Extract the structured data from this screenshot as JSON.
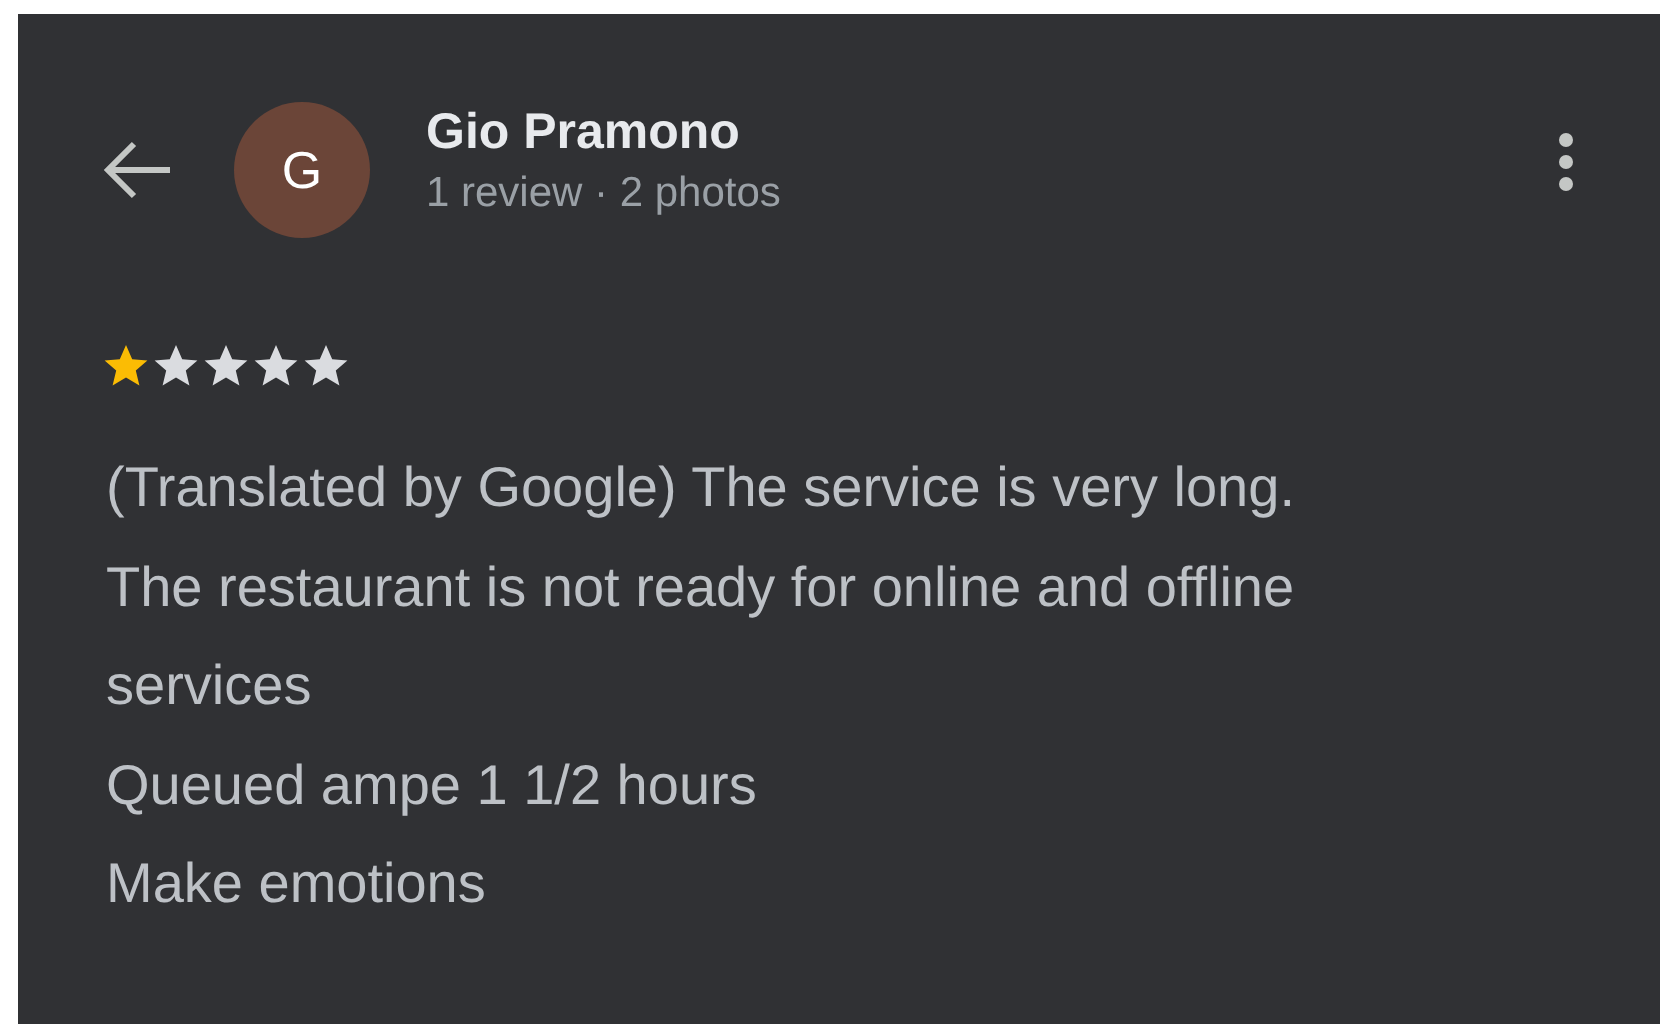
{
  "header": {
    "avatar_letter": "G",
    "name": "Gio Pramono",
    "meta": "1 review · 2 photos"
  },
  "review": {
    "stars": 1,
    "lines": [
      "(Translated by Google) The service is very long.",
      "The restaurant is not ready for online and offline",
      "services",
      "Queued ampe 1 1/2 hours",
      "Make emotions"
    ]
  }
}
